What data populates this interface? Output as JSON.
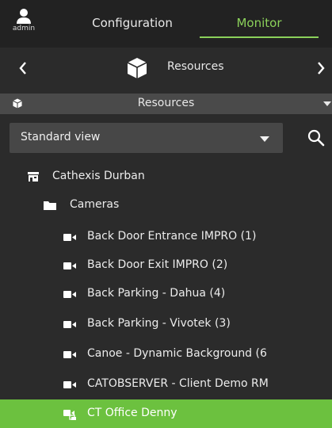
{
  "header": {
    "user_label": "admin",
    "tabs": [
      {
        "label": "Configuration",
        "active": false
      },
      {
        "label": "Monitor",
        "active": true
      }
    ],
    "accent_color": "#8bd15a"
  },
  "nav": {
    "title": "Resources",
    "prev_icon": "chevron-left-icon",
    "next_icon": "chevron-right-icon"
  },
  "section": {
    "title": "Resources"
  },
  "view_select": {
    "value": "Standard view"
  },
  "tree": {
    "site": {
      "label": "Cathexis Durban",
      "icon": "server-icon",
      "expanded": true
    },
    "folder": {
      "label": "Cameras",
      "icon": "folder-icon",
      "expanded": true
    },
    "cameras": [
      {
        "label": "Back Door Entrance IMPRO (1)",
        "selected": false
      },
      {
        "label": "Back Door Exit IMPRO (2)",
        "selected": false
      },
      {
        "label": "Back Parking - Dahua (4)",
        "selected": false
      },
      {
        "label": "Back Parking - Vivotek (3)",
        "selected": false
      },
      {
        "label": "Canoe - Dynamic Background (6",
        "selected": false
      },
      {
        "label": "CATOBSERVER - Client Demo RM",
        "selected": false
      },
      {
        "label": "CT Office Denny",
        "selected": true
      }
    ],
    "selected_color": "#6cc13f"
  }
}
